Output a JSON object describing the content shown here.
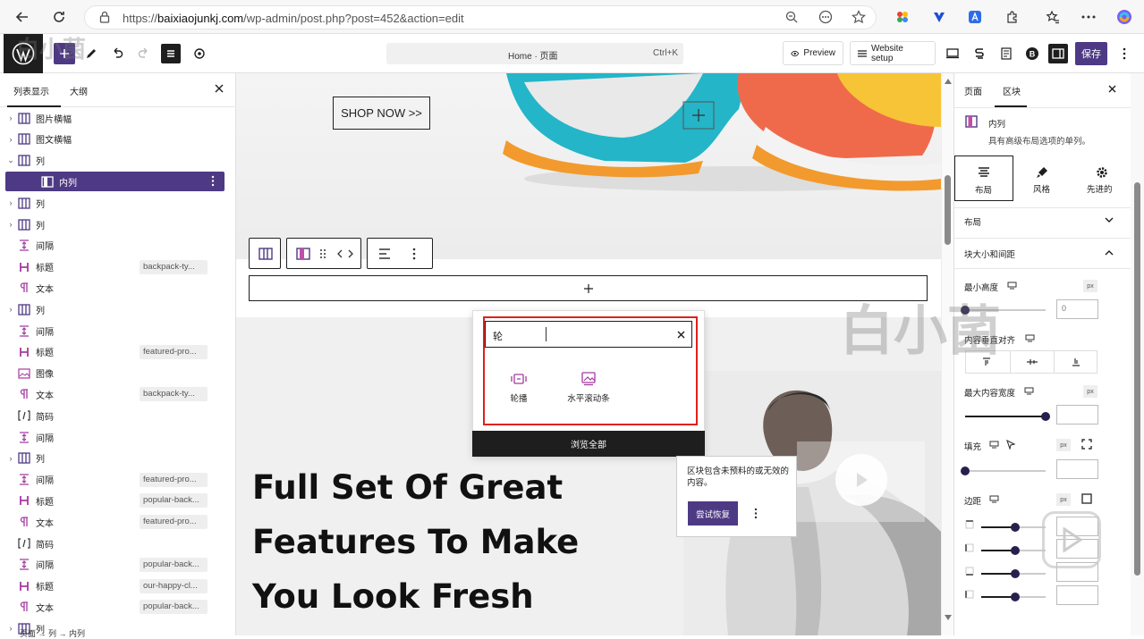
{
  "browser": {
    "url_prefix": "https://",
    "url_domain": "baixiaojunkj.com",
    "url_path": "/wp-admin/post.php?post=452&action=edit"
  },
  "toolbar": {
    "doc_title": "Home · 页面",
    "doc_shortcut": "Ctrl+K",
    "preview_label": "Preview",
    "website_setup_label": "Website setup",
    "save_label": "保存"
  },
  "list_view": {
    "tab_list": "列表显示",
    "tab_outline": "大纲",
    "rows": [
      {
        "label": "图片横幅",
        "chev": "›",
        "icon": "columns",
        "tag": ""
      },
      {
        "label": "图文横幅",
        "chev": "›",
        "icon": "columns",
        "tag": ""
      },
      {
        "label": "列",
        "chev": "⌄",
        "icon": "columns",
        "tag": ""
      },
      {
        "label": "内列",
        "chev": "",
        "icon": "column",
        "tag": "",
        "selected": true
      },
      {
        "label": "列",
        "chev": "›",
        "icon": "columns",
        "tag": ""
      },
      {
        "label": "列",
        "chev": "›",
        "icon": "columns",
        "tag": ""
      },
      {
        "label": "间隔",
        "chev": "",
        "icon": "spacer",
        "tag": ""
      },
      {
        "label": "标题",
        "chev": "",
        "icon": "heading",
        "tag": "backpack-ty..."
      },
      {
        "label": "文本",
        "chev": "",
        "icon": "paragraph",
        "tag": ""
      },
      {
        "label": "列",
        "chev": "›",
        "icon": "columns",
        "tag": ""
      },
      {
        "label": "间隔",
        "chev": "",
        "icon": "spacer",
        "tag": ""
      },
      {
        "label": "标题",
        "chev": "",
        "icon": "heading",
        "tag": "featured-pro..."
      },
      {
        "label": "图像",
        "chev": "",
        "icon": "image",
        "tag": ""
      },
      {
        "label": "文本",
        "chev": "",
        "icon": "paragraph",
        "tag": "backpack-ty..."
      },
      {
        "label": "简码",
        "chev": "",
        "icon": "shortcode",
        "tag": ""
      },
      {
        "label": "间隔",
        "chev": "",
        "icon": "spacer",
        "tag": ""
      },
      {
        "label": "列",
        "chev": "›",
        "icon": "columns",
        "tag": ""
      },
      {
        "label": "间隔",
        "chev": "",
        "icon": "spacer",
        "tag": "featured-pro..."
      },
      {
        "label": "标题",
        "chev": "",
        "icon": "heading",
        "tag": "popular-back..."
      },
      {
        "label": "文本",
        "chev": "",
        "icon": "paragraph",
        "tag": "featured-pro..."
      },
      {
        "label": "简码",
        "chev": "",
        "icon": "shortcode",
        "tag": ""
      },
      {
        "label": "间隔",
        "chev": "",
        "icon": "spacer",
        "tag": "popular-back..."
      },
      {
        "label": "标题",
        "chev": "",
        "icon": "heading",
        "tag": "our-happy-cl..."
      },
      {
        "label": "文本",
        "chev": "",
        "icon": "paragraph",
        "tag": "popular-back..."
      },
      {
        "label": "列",
        "chev": "›",
        "icon": "columns",
        "tag": ""
      }
    ],
    "breadcrumb": "页面  →  列  →  内列"
  },
  "canvas": {
    "shop_button": "SHOP NOW >>",
    "headline_lines": [
      "Full Set Of Great",
      "Features To Make",
      "You Look Fresh"
    ]
  },
  "quick_inserter": {
    "search_value": "轮",
    "results": [
      {
        "label": "轮播",
        "icon": "carousel-icon"
      },
      {
        "label": "水平滚动条",
        "icon": "horizontal-scroll-icon"
      }
    ],
    "browse_all": "浏览全部"
  },
  "invalid_block": {
    "message": "区块包含未预料的或无效的内容。",
    "recover_label": "尝试恢复"
  },
  "settings": {
    "tab_page": "页面",
    "tab_block": "区块",
    "block_name": "内列",
    "block_desc": "具有高级布局选项的单列。",
    "subtabs": [
      "布局",
      "风格",
      "先进的"
    ],
    "layout_section": "布局",
    "size_section": "块大小和间距",
    "min_height_label": "最小高度",
    "min_height_value": "0",
    "vertical_align_label": "内容垂直对齐",
    "max_width_label": "最大内容宽度",
    "padding_label": "填充",
    "margin_label": "边距",
    "unit": "px"
  },
  "watermark": {
    "top_left": "白小菌",
    "right": "白小菌"
  },
  "colors": {
    "accent": "#4e3a84",
    "highlight_border": "#e0201c"
  }
}
